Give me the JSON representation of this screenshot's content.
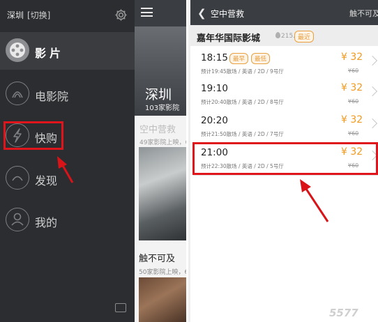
{
  "drawer": {
    "city": "深圳",
    "switch_label": "[切换]",
    "settings_icon": "gear-icon",
    "items": [
      {
        "label": "影片",
        "icon": "film-reel-icon"
      },
      {
        "label": "电影院",
        "icon": "cinema-icon"
      },
      {
        "label": "快购",
        "icon": "lightning-icon"
      },
      {
        "label": "发现",
        "icon": "discover-icon"
      },
      {
        "label": "我的",
        "icon": "user-icon"
      }
    ],
    "chat_icon": "chat-icon"
  },
  "middle": {
    "menu_icon": "hamburger-icon",
    "city": "深圳",
    "cinema_count": "103家影院",
    "movies": [
      {
        "title": "空中营救",
        "meta": "49家影院上映，6"
      },
      {
        "title": "触不可及",
        "meta": "50家影院上映，6"
      }
    ]
  },
  "right": {
    "back_icon": "chevron-left-icon",
    "title": "空中营救",
    "next_movie": "触不可及",
    "cinema_name": "嘉年华国际影城",
    "distance": "215.6km",
    "near_tag": "最近",
    "showtimes": [
      {
        "time": "18:15",
        "tags": [
          "最早",
          "最低"
        ],
        "meta": "预计19:45散场 / 英语 / 2D / 9号厅",
        "price": "¥ 32",
        "original": "¥60"
      },
      {
        "time": "19:10",
        "tags": [],
        "meta": "预计20:40散场 / 英语 / 2D / 8号厅",
        "price": "¥ 32",
        "original": "¥60"
      },
      {
        "time": "20:20",
        "tags": [],
        "meta": "预计21:50散场 / 英语 / 2D / 7号厅",
        "price": "¥ 32",
        "original": "¥60"
      },
      {
        "time": "21:00",
        "tags": [],
        "meta": "预计22:30散场 / 英语 / 2D / 5号厅",
        "price": "¥ 32",
        "original": "¥60"
      }
    ]
  },
  "watermark": "5577",
  "colors": {
    "highlight": "#e0141b",
    "price": "#f09a1e",
    "drawer_bg": "#2b2d30",
    "topbar": "#3a3d41"
  }
}
